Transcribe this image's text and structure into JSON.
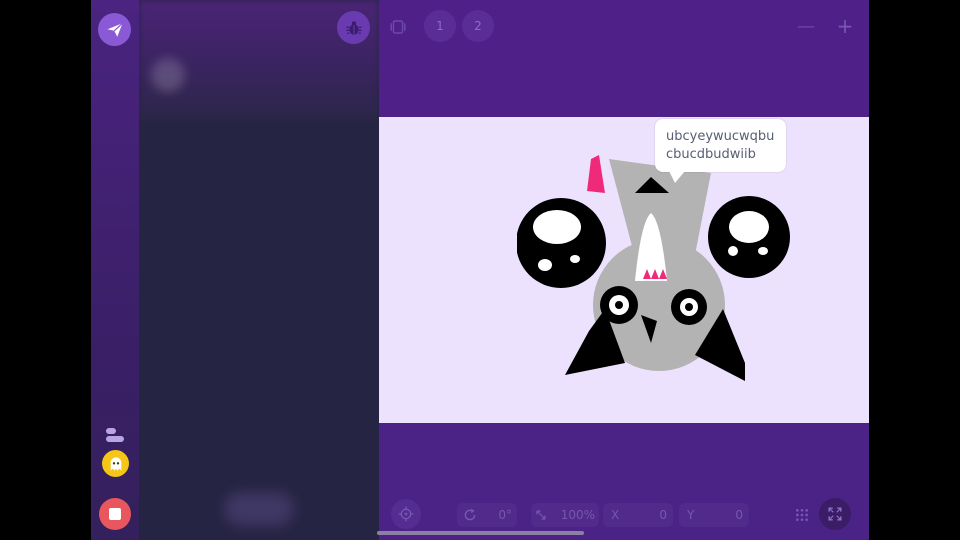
{
  "rail": {
    "send_icon": "paper-plane-icon",
    "toggle_icon": "toggle-icon",
    "ghost_icon": "ghost-icon",
    "stop_icon": "stop-icon",
    "colors": {
      "send": "#8a5ad6",
      "stop": "#e8575d",
      "ghost": "#f5c518"
    }
  },
  "panel": {
    "debug_icon": "bug-icon"
  },
  "toolbar": {
    "frame_icon": "frame-icon",
    "pages": [
      "1",
      "2"
    ],
    "zoom_out_label": "—",
    "zoom_in_label": "+"
  },
  "stage": {
    "background": "#ede2fd",
    "speech_bubble": {
      "lines": [
        "ubcyeywucwqbu",
        "cbucdbudwiib"
      ]
    }
  },
  "bottom_bar": {
    "recenter_icon": "crosshair-icon",
    "rotation": {
      "icon": "rotate-icon",
      "value": "0°"
    },
    "scale": {
      "icon": "resize-icon",
      "value": "100%"
    },
    "x": {
      "label": "X",
      "value": "0"
    },
    "y": {
      "label": "Y",
      "value": "0"
    },
    "grid_icon": "grid-icon",
    "fullscreen_icon": "fullscreen-icon"
  }
}
